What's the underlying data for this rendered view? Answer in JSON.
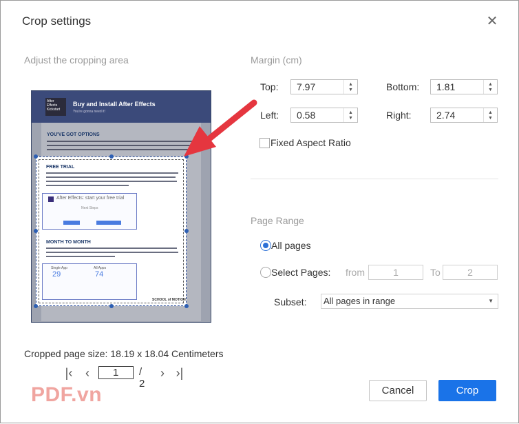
{
  "dialog": {
    "title": "Crop settings",
    "close_icon": "close-icon"
  },
  "left": {
    "section_label": "Adjust the cropping area",
    "preview": {
      "header_logo": "After Effects Kickstart",
      "header_title": "Buy and Install After Effects",
      "header_subtitle": "You're gonna need it!",
      "heading_1": "YOU'VE GOT OPTIONS",
      "heading_2": "FREE TRIAL",
      "card_1": "After Effects: start your free trial",
      "card_1_sub": "Next Steps",
      "heading_3": "MONTH TO MONTH",
      "plan_1": "Single App",
      "plan_1_price": "29",
      "plan_2": "All Apps",
      "plan_2_price": "74",
      "footer_brand": "SCHOOL of MOTION"
    },
    "cropped_size": "Cropped page size: 18.19 x 18.04 Centimeters",
    "pager": {
      "first_icon": "first-page-icon",
      "prev_icon": "prev-page-icon",
      "current": "1",
      "total": "/ 2",
      "next_icon": "next-page-icon",
      "last_icon": "last-page-icon"
    },
    "watermark": "PDF.vn"
  },
  "margin": {
    "section_label": "Margin (cm)",
    "top_label": "Top:",
    "top_value": "7.97",
    "bottom_label": "Bottom:",
    "bottom_value": "1.81",
    "left_label": "Left:",
    "left_value": "0.58",
    "right_label": "Right:",
    "right_value": "2.74",
    "fixed_aspect_label": "Fixed Aspect Ratio",
    "fixed_aspect_checked": false
  },
  "page_range": {
    "section_label": "Page Range",
    "all_pages_label": "All pages",
    "all_pages_selected": true,
    "select_pages_label": "Select Pages:",
    "from_label": "from",
    "from_value": "1",
    "to_label": "To",
    "to_value": "2",
    "subset_label": "Subset:",
    "subset_value": "All pages in range"
  },
  "buttons": {
    "cancel": "Cancel",
    "crop": "Crop"
  },
  "colors": {
    "accent": "#1a73e8",
    "crop_handle": "#2d5fb3",
    "arrow": "#e5363f"
  }
}
